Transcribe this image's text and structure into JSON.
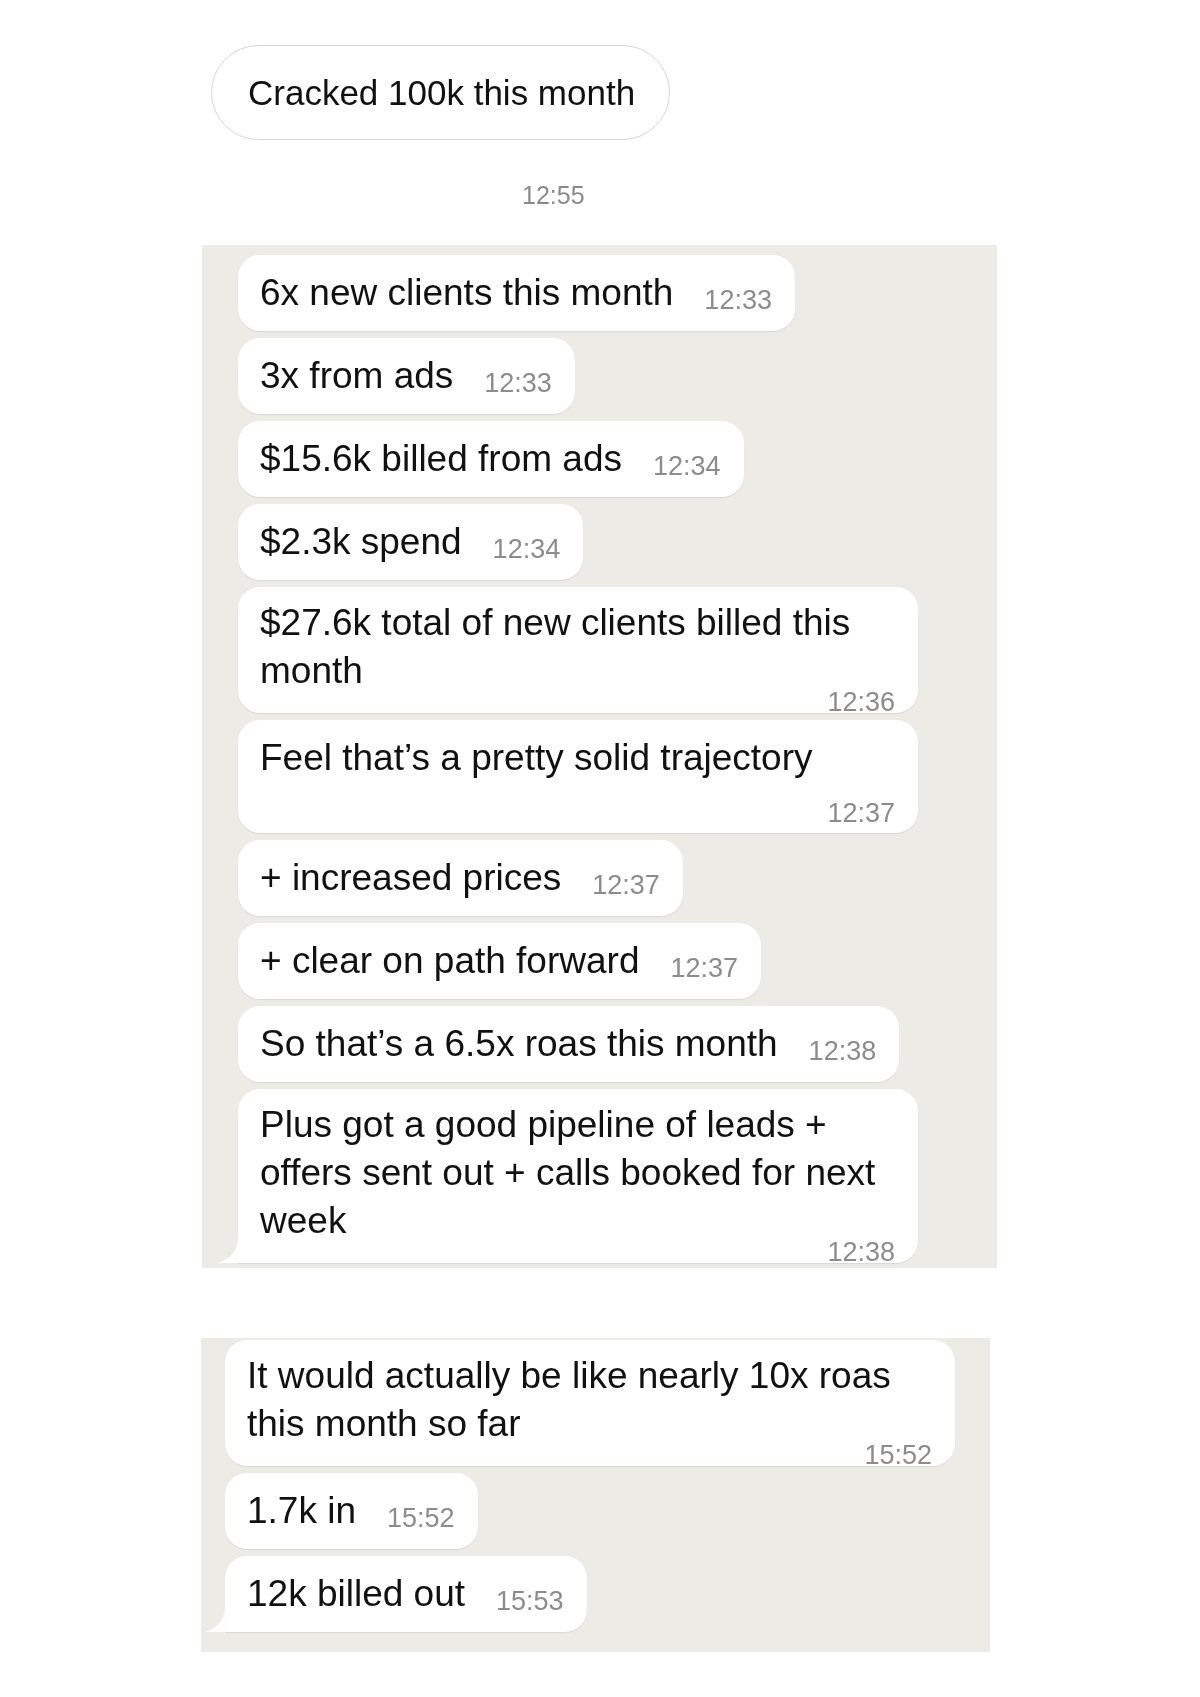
{
  "top_message": {
    "text": "Cracked 100k this month",
    "time": "12:55"
  },
  "chat_panels": [
    {
      "messages": [
        {
          "text": "6x new clients this month",
          "time": "12:33"
        },
        {
          "text": "3x from ads",
          "time": "12:33"
        },
        {
          "text": "$15.6k billed from ads",
          "time": "12:34"
        },
        {
          "text": "$2.3k spend",
          "time": "12:34"
        },
        {
          "text": "$27.6k total of new clients billed this month",
          "time": "12:36"
        },
        {
          "text": "Feel that’s a pretty solid trajectory",
          "time": "12:37"
        },
        {
          "text": "+ increased prices",
          "time": "12:37"
        },
        {
          "text": "+ clear on path forward",
          "time": "12:37"
        },
        {
          "text": "So that’s a 6.5x roas this month",
          "time": "12:38"
        },
        {
          "text": "Plus got a good pipeline of leads + offers sent out + calls booked for next week",
          "time": "12:38"
        }
      ]
    },
    {
      "messages": [
        {
          "text": "It would actually be like nearly 10x roas this month so far",
          "time": "15:52"
        },
        {
          "text": "1.7k in",
          "time": "15:52"
        },
        {
          "text": "12k billed out",
          "time": "15:53"
        }
      ]
    }
  ]
}
